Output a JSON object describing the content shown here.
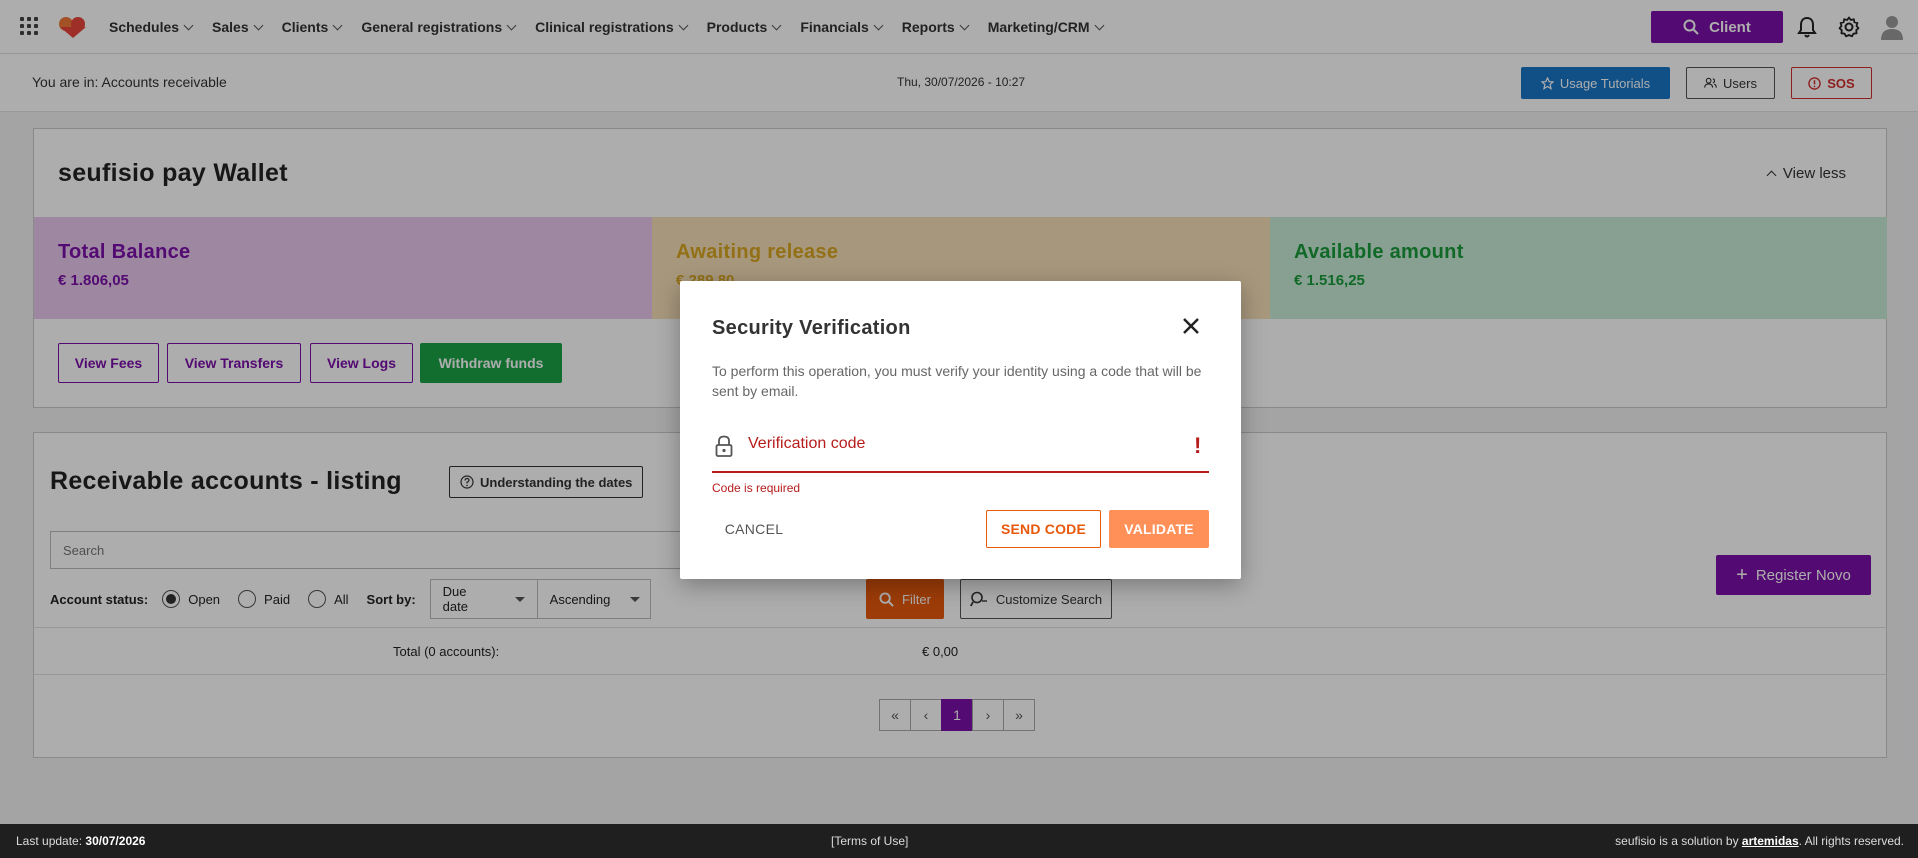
{
  "topnav": {
    "menu": [
      {
        "label": "Schedules"
      },
      {
        "label": "Sales"
      },
      {
        "label": "Clients"
      },
      {
        "label": "General registrations"
      },
      {
        "label": "Clinical registrations"
      },
      {
        "label": "Products"
      },
      {
        "label": "Financials"
      },
      {
        "label": "Reports"
      },
      {
        "label": "Marketing/CRM"
      }
    ],
    "client_button": "Client",
    "icons": [
      "apps-grid-icon",
      "logo",
      "search-icon",
      "bell-icon",
      "gear-icon",
      "user-avatar-icon"
    ],
    "accent_color": "#7b0fa8"
  },
  "subbar": {
    "breadcrumb": "You are in: Accounts receivable",
    "datetime": "Thu, 30/07/2026 - 10:27",
    "usage_tutorials": "Usage Tutorials",
    "users": "Users",
    "sos": "SOS"
  },
  "wallet": {
    "title": "seufisio pay Wallet",
    "view_less": "View less",
    "balances": [
      {
        "label": "Total Balance",
        "value": "€ 1.806,05",
        "color": "#7b0fa8"
      },
      {
        "label": "Awaiting release",
        "value": "€ 289,80",
        "color": "#d9a521"
      },
      {
        "label": "Available amount",
        "value": "€ 1.516,25",
        "color": "#1a9b3c"
      }
    ],
    "buttons": {
      "fees": "View Fees",
      "transfers": "View Transfers",
      "logs": "View Logs",
      "withdraw": "Withdraw funds"
    }
  },
  "listing": {
    "title": "Receivable accounts - listing",
    "understanding_dates": "Understanding the dates",
    "search_placeholder": "Search",
    "account_status_label": "Account status:",
    "status_options": [
      "Open",
      "Paid",
      "All"
    ],
    "status_selected": "Open",
    "sort_by_label": "Sort by:",
    "sort_field": "Due date",
    "sort_order": "Ascending",
    "filter": "Filter",
    "customize_search": "Customize Search",
    "register_new": "Register Novo",
    "total_label": "Total (0 accounts):",
    "total_value": "€ 0,00",
    "current_page": "1"
  },
  "footer": {
    "last_update_label": "Last update:",
    "last_update_value": "30/07/2026",
    "terms": "[Terms of Use]",
    "credit_prefix": "seufisio is a solution by",
    "credit_link": "artemidas",
    "credit_suffix": ". All rights reserved."
  },
  "modal": {
    "title": "Security Verification",
    "description": "To perform this operation, you must verify your identity using a code that will be sent by email.",
    "field_label": "Verification code",
    "error": "Code is required",
    "cancel": "CANCEL",
    "send_code": "SEND CODE",
    "validate": "VALIDATE",
    "error_color": "#b71c1c"
  }
}
